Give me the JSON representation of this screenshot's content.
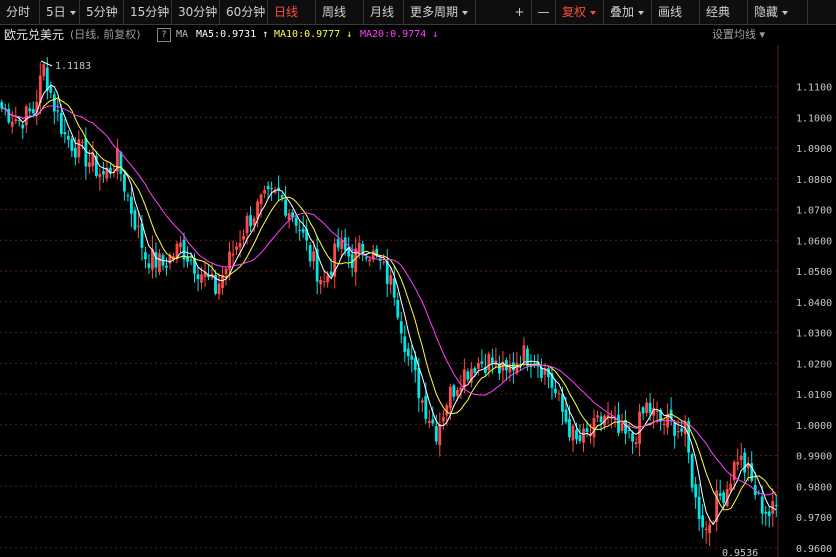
{
  "toolbar": {
    "periods": [
      {
        "label": "分时",
        "active": false,
        "caret": false,
        "w": 40
      },
      {
        "label": "5日",
        "active": false,
        "caret": true,
        "w": 40
      },
      {
        "label": "5分钟",
        "active": false,
        "caret": false,
        "w": 44
      },
      {
        "label": "15分钟",
        "active": false,
        "caret": false,
        "w": 48
      },
      {
        "label": "30分钟",
        "active": false,
        "caret": false,
        "w": 48
      },
      {
        "label": "60分钟",
        "active": false,
        "caret": false,
        "w": 48
      },
      {
        "label": "日线",
        "active": true,
        "caret": false,
        "w": 48
      },
      {
        "label": "周线",
        "active": false,
        "caret": false,
        "w": 48
      },
      {
        "label": "月线",
        "active": false,
        "caret": false,
        "w": 40
      },
      {
        "label": "更多周期",
        "active": false,
        "caret": true,
        "w": 72
      }
    ],
    "tools": [
      {
        "label": "+",
        "active": false,
        "caret": false,
        "w": 24,
        "sq": true
      },
      {
        "label": "—",
        "active": false,
        "caret": false,
        "w": 24,
        "sq": true
      },
      {
        "label": "复权",
        "active": true,
        "caret": true,
        "w": 48
      },
      {
        "label": "叠加",
        "active": false,
        "caret": true,
        "w": 48
      },
      {
        "label": "画线",
        "active": false,
        "caret": false,
        "w": 48
      },
      {
        "label": "经典",
        "active": false,
        "caret": false,
        "w": 48
      },
      {
        "label": "隐藏",
        "active": false,
        "caret": true,
        "w": 60
      }
    ]
  },
  "info": {
    "title": "欧元兑美元",
    "subtitle": "(日线, 前复权)",
    "help": "?",
    "ma_label": "MA",
    "ma5": "MA5:0.9731 ↑",
    "ma10": "MA10:0.9777 ↓",
    "ma20": "MA20:0.9774 ↓",
    "settings": "设置均线 ▾"
  },
  "colors": {
    "up": "#ff4a4a",
    "down": "#00e5e5",
    "ma5": "#ffffff",
    "ma10": "#ffff40",
    "ma20": "#ff40ff",
    "grid": "#5a1e1e"
  },
  "chart_data": {
    "type": "candlestick",
    "y_range": [
      0.957,
      1.1235
    ],
    "y_ticks": [
      "1.1100",
      "1.1000",
      "1.0900",
      "1.0800",
      "1.0700",
      "1.0600",
      "1.0500",
      "1.0400",
      "1.0300",
      "1.0200",
      "1.0100",
      "1.0000",
      "0.9900",
      "0.9800",
      "0.9700",
      "0.9600"
    ],
    "y_tick_values": [
      1.11,
      1.1,
      1.09,
      1.08,
      1.07,
      1.06,
      1.05,
      1.04,
      1.03,
      1.02,
      1.01,
      1.0,
      0.99,
      0.98,
      0.97,
      0.96
    ],
    "annotations": [
      {
        "label": "1.1183",
        "value": 1.1183
      }
    ],
    "bottom_label": "0.9536",
    "anchors": [
      [
        0,
        1.103
      ],
      [
        5,
        1.099
      ],
      [
        9,
        1.102
      ],
      [
        12,
        1.116
      ],
      [
        15,
        1.104
      ],
      [
        18,
        1.094
      ],
      [
        24,
        1.087
      ],
      [
        29,
        1.081
      ],
      [
        33,
        1.086
      ],
      [
        37,
        1.07
      ],
      [
        41,
        1.055
      ],
      [
        46,
        1.052
      ],
      [
        51,
        1.058
      ],
      [
        56,
        1.051
      ],
      [
        61,
        1.044
      ],
      [
        66,
        1.056
      ],
      [
        70,
        1.066
      ],
      [
        74,
        1.072
      ],
      [
        79,
        1.075
      ],
      [
        84,
        1.067
      ],
      [
        88,
        1.055
      ],
      [
        92,
        1.046
      ],
      [
        96,
        1.058
      ],
      [
        100,
        1.054
      ],
      [
        104,
        1.058
      ],
      [
        108,
        1.052
      ],
      [
        112,
        1.044
      ],
      [
        116,
        1.022
      ],
      [
        120,
        1.008
      ],
      [
        124,
        0.998
      ],
      [
        127,
        1.008
      ],
      [
        131,
        1.016
      ],
      [
        135,
        1.02
      ],
      [
        139,
        1.021
      ],
      [
        144,
        1.016
      ],
      [
        148,
        1.023
      ],
      [
        152,
        1.022
      ],
      [
        156,
        1.016
      ],
      [
        160,
        1.004
      ],
      [
        164,
        0.994
      ],
      [
        168,
        0.997
      ],
      [
        172,
        1.003
      ],
      [
        176,
        0.997
      ],
      [
        180,
        0.995
      ],
      [
        184,
        1.006
      ],
      [
        188,
        1.001
      ],
      [
        192,
        1.0
      ],
      [
        195,
        0.997
      ],
      [
        198,
        0.975
      ],
      [
        201,
        0.966
      ],
      [
        204,
        0.975
      ],
      [
        207,
        0.98
      ],
      [
        210,
        0.99
      ],
      [
        213,
        0.984
      ],
      [
        216,
        0.975
      ],
      [
        219,
        0.971
      ],
      [
        221,
        0.973
      ]
    ]
  }
}
